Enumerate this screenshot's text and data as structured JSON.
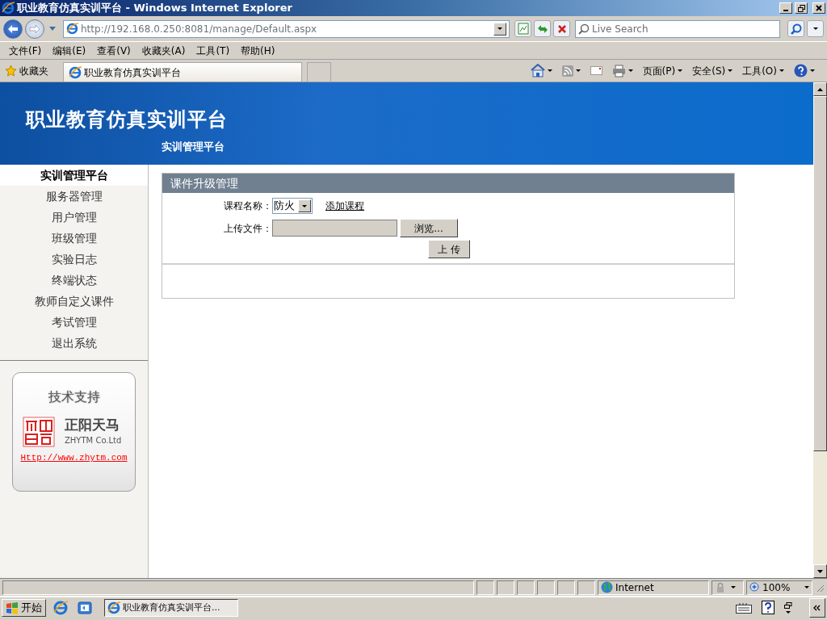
{
  "window": {
    "title": "职业教育仿真实训平台 - Windows Internet Explorer"
  },
  "address_bar": {
    "url": "http://192.168.0.250:8081/manage/Default.aspx"
  },
  "search": {
    "placeholder": "Live Search"
  },
  "menu_bar": [
    "文件(F)",
    "编辑(E)",
    "查看(V)",
    "收藏夹(A)",
    "工具(T)",
    "帮助(H)"
  ],
  "favorites": {
    "label": "收藏夹"
  },
  "tabs": [
    {
      "label": "职业教育仿真实训平台",
      "selected": true
    }
  ],
  "command_bar": [
    "页面(P)",
    "安全(S)",
    "工具(O)"
  ],
  "banner": {
    "title": "职业教育仿真实训平台",
    "subtitle": "实训管理平台"
  },
  "sidebar": {
    "items": [
      {
        "label": "实训管理平台",
        "selected": true
      },
      {
        "label": "服务器管理",
        "selected": false
      },
      {
        "label": "用户管理",
        "selected": false
      },
      {
        "label": "班级管理",
        "selected": false
      },
      {
        "label": "实验日志",
        "selected": false
      },
      {
        "label": "终端状态",
        "selected": false
      },
      {
        "label": "教师自定义课件",
        "selected": false
      },
      {
        "label": "考试管理",
        "selected": false
      },
      {
        "label": "退出系统",
        "selected": false
      }
    ]
  },
  "support": {
    "title": "技术支持",
    "company": "正阳天马",
    "company_en": "ZHYTM Co.Ltd",
    "url": "Http://www.zhytm.com"
  },
  "panel": {
    "title": "课件升级管理",
    "course_label": "课程名称：",
    "course_value": "防火",
    "add_link": "添加课程",
    "file_label": "上传文件：",
    "browse_button": "浏览...",
    "upload_button": "上 传"
  },
  "status_bar": {
    "zone": "Internet",
    "zoom": "100%"
  },
  "taskbar": {
    "start": "开始",
    "tasks": [
      {
        "label": "职业教育仿真实训平台...",
        "selected": true
      }
    ]
  }
}
